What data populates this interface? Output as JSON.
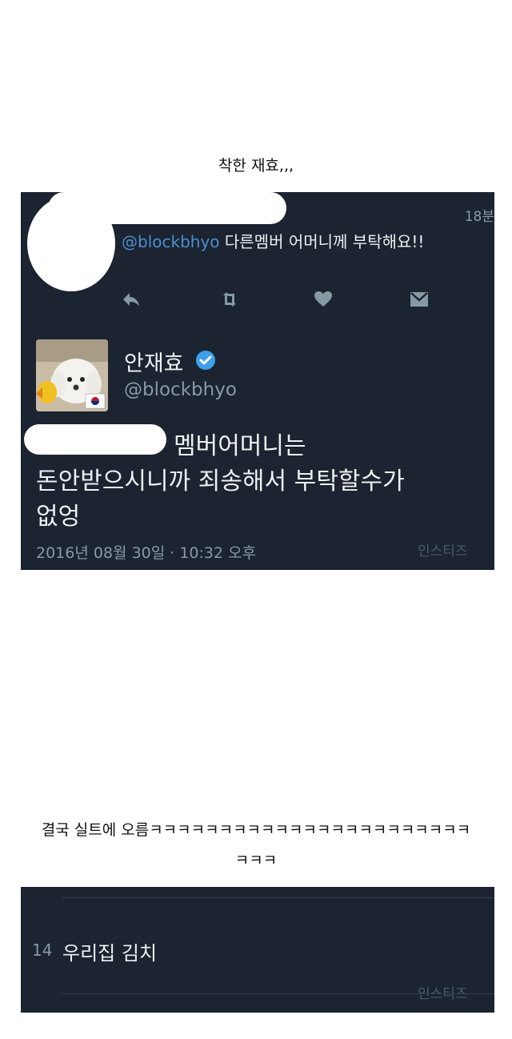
{
  "caption_top": "착한 재효,,,",
  "tweet_reply": {
    "time_ago": "18분",
    "mention": "@blockbhyo",
    "text": " 다른멤버 어머니께 부탁해요!!",
    "actions": [
      "reply-icon",
      "retweet-icon",
      "like-icon",
      "dm-icon"
    ]
  },
  "tweet_main": {
    "display_name": "안재효",
    "username": "@blockbhyo",
    "body_line1": "멤버어머니는",
    "body_line2": "돈안받으시니까 죄송해서 부탁할수가",
    "body_line3": "없엉",
    "timestamp": "2016년 08월 30일 · 10:32 오후",
    "watermark": "인스티즈"
  },
  "caption_bottom_line1": "결국 실트에 오름ㅋㅋㅋㅋㅋㅋㅋㅋㅋㅋㅋㅋㅋㅋㅋㅋㅋㅋㅋㅋㅋㅋㅋ",
  "caption_bottom_line2": "ㅋㅋㅋ",
  "trend": {
    "rank": "14",
    "name": "우리집 김치",
    "watermark": "인스티즈"
  },
  "colors": {
    "panel_bg": "#1b2430",
    "link": "#4a8fd0",
    "muted": "#8899a6"
  }
}
